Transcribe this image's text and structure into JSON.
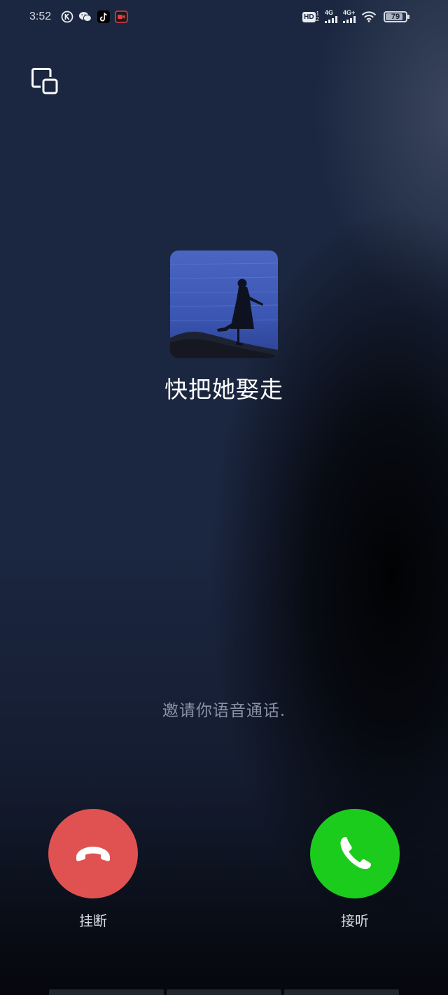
{
  "status_bar": {
    "time": "3:52",
    "left_icons": [
      "k-app-icon",
      "wechat-icon",
      "tiktok-icon",
      "video-recorder-icon"
    ],
    "hd_label": "HD",
    "sim1_label": "4G",
    "sim2_label": "4G+",
    "battery_level": "79"
  },
  "call": {
    "caller_name": "快把她娶走",
    "invite_text": "邀请你语音通话.",
    "hangup_label": "挂断",
    "answer_label": "接听"
  },
  "colors": {
    "hangup": "#e05252",
    "answer": "#1ccc1c",
    "background": "#1b2640"
  }
}
